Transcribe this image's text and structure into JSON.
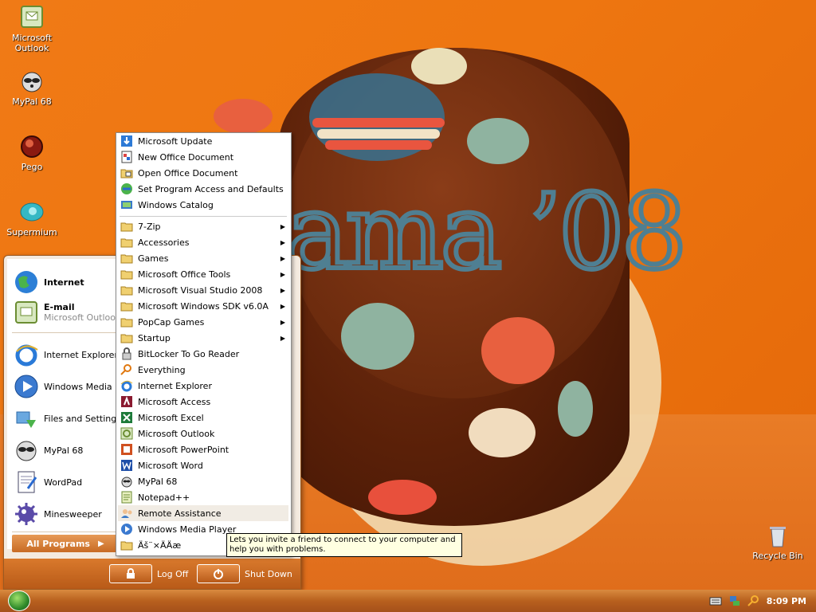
{
  "desktop": {
    "icons": [
      {
        "label": "Microsoft Outlook",
        "icon": "outlook-icon"
      },
      {
        "label": "MyPal 68",
        "icon": "mypal-icon"
      },
      {
        "label": "Pego",
        "icon": "pego-icon"
      },
      {
        "label": "Supermium",
        "icon": "supermium-icon"
      },
      {
        "label": "Recycle Bin",
        "icon": "recycle-bin-icon"
      }
    ]
  },
  "start_menu": {
    "pinned": [
      {
        "title": "Internet",
        "icon": "globe-icon"
      },
      {
        "title": "E-mail",
        "subtitle": "Microsoft Outlook",
        "icon": "outlook-icon"
      }
    ],
    "recent": [
      {
        "label": "Internet Explorer",
        "icon": "ie-icon"
      },
      {
        "label": "Windows Media Player",
        "icon": "media-player-icon"
      },
      {
        "label": "Files and Settings",
        "icon": "files-settings-icon"
      },
      {
        "label": "MyPal 68",
        "icon": "mypal-icon"
      },
      {
        "label": "WordPad",
        "icon": "wordpad-icon"
      },
      {
        "label": "Minesweeper",
        "icon": "minesweeper-icon"
      }
    ],
    "all_programs": "All Programs",
    "log_off": "Log Off",
    "shut_down": "Shut Down"
  },
  "programs": {
    "top": [
      {
        "label": "Microsoft Update",
        "icon": "update-icon"
      },
      {
        "label": "New Office Document",
        "icon": "new-doc-icon"
      },
      {
        "label": "Open Office Document",
        "icon": "open-doc-icon"
      },
      {
        "label": "Set Program Access and Defaults",
        "icon": "defaults-icon"
      },
      {
        "label": "Windows Catalog",
        "icon": "catalog-icon"
      }
    ],
    "items": [
      {
        "label": "7-Zip",
        "icon": "folder-icon",
        "sub": true
      },
      {
        "label": "Accessories",
        "icon": "folder-icon",
        "sub": true
      },
      {
        "label": "Games",
        "icon": "folder-icon",
        "sub": true
      },
      {
        "label": "Microsoft Office Tools",
        "icon": "folder-icon",
        "sub": true
      },
      {
        "label": "Microsoft Visual Studio 2008",
        "icon": "folder-icon",
        "sub": true
      },
      {
        "label": "Microsoft Windows SDK v6.0A",
        "icon": "folder-icon",
        "sub": true
      },
      {
        "label": "PopCap Games",
        "icon": "folder-icon",
        "sub": true
      },
      {
        "label": "Startup",
        "icon": "folder-icon",
        "sub": true
      },
      {
        "label": "BitLocker To Go Reader",
        "icon": "bitlocker-icon",
        "sub": false
      },
      {
        "label": "Everything",
        "icon": "search-icon",
        "sub": false
      },
      {
        "label": "Internet Explorer",
        "icon": "ie-icon",
        "sub": false
      },
      {
        "label": "Microsoft Access",
        "icon": "access-icon",
        "sub": false
      },
      {
        "label": "Microsoft Excel",
        "icon": "excel-icon",
        "sub": false
      },
      {
        "label": "Microsoft Outlook",
        "icon": "outlook-icon",
        "sub": false
      },
      {
        "label": "Microsoft PowerPoint",
        "icon": "powerpoint-icon",
        "sub": false
      },
      {
        "label": "Microsoft Word",
        "icon": "word-icon",
        "sub": false
      },
      {
        "label": "MyPal 68",
        "icon": "mypal-icon",
        "sub": false
      },
      {
        "label": "Notepad++",
        "icon": "notepad-icon",
        "sub": false
      },
      {
        "label": "Remote Assistance",
        "icon": "remote-assistance-icon",
        "sub": false,
        "highlighted": true
      },
      {
        "label": "Windows Media Player",
        "icon": "media-player-icon",
        "sub": false
      },
      {
        "label": "Äš¨×ÄÄæ",
        "icon": "folder-icon",
        "sub": false
      }
    ]
  },
  "tooltip": "Lets you invite a friend to connect to your computer and help you with problems.",
  "taskbar": {
    "clock": "8:09 PM"
  },
  "colors": {
    "taskbar": "#b8601e",
    "menu_footer": "#c86b24",
    "highlight": "#f1ece4"
  }
}
